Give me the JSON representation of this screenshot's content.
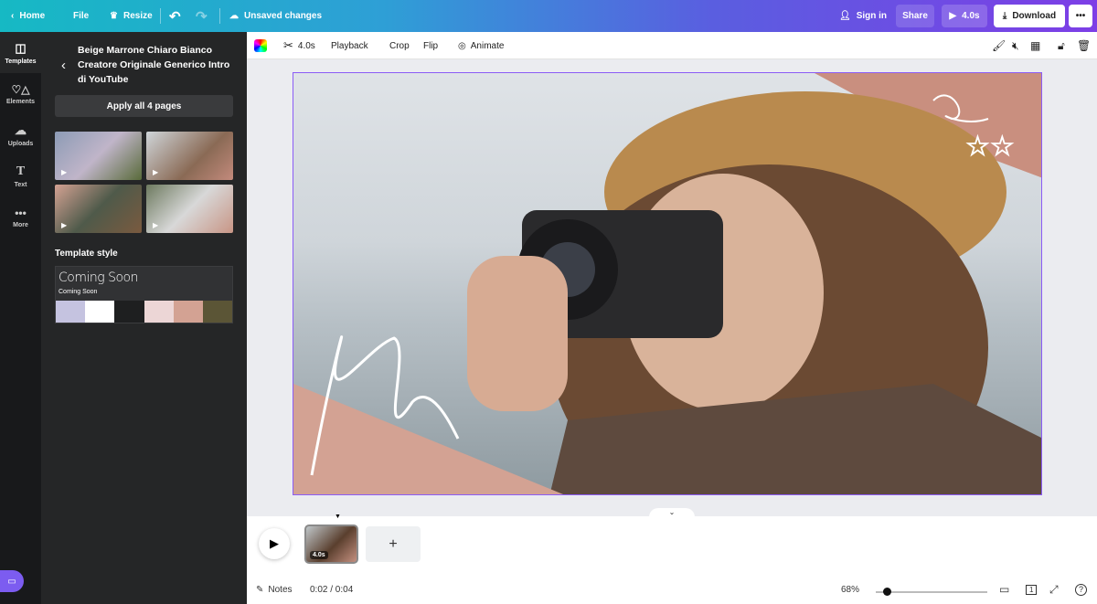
{
  "topbar": {
    "home": "Home",
    "file": "File",
    "resize": "Resize",
    "status": "Unsaved changes",
    "sign_in": "Sign in",
    "share": "Share",
    "play_duration": "4.0s",
    "download": "Download"
  },
  "rail": [
    {
      "label": "Templates"
    },
    {
      "label": "Elements"
    },
    {
      "label": "Uploads"
    },
    {
      "label": "Text"
    },
    {
      "label": "More"
    }
  ],
  "panel": {
    "title": "Beige Marrone Chiaro Bianco Creatore Originale Generico Intro di YouTube",
    "apply_button": "Apply all 4 pages",
    "style_heading": "Template style",
    "font_preview_title": "Coming Soon",
    "font_preview_body": "Coming Soon",
    "palette": [
      "#c5c3e0",
      "#ffffff",
      "#1e1f20",
      "#ecd6d6",
      "#d3a293",
      "#5b5536"
    ]
  },
  "toolbar": {
    "duration": "4.0s",
    "playback": "Playback",
    "crop": "Crop",
    "flip": "Flip",
    "animate": "Animate"
  },
  "timeline": {
    "page_duration": "4.0s"
  },
  "bottom": {
    "notes": "Notes",
    "time": "0:02 / 0:04",
    "zoom": "68%",
    "zoom_slider_fraction": 0.1,
    "page_count": "1"
  },
  "colors": {
    "accent": "#8b5cf6",
    "topbar_start": "#16b9c4",
    "topbar_end": "#7d3ee6"
  }
}
